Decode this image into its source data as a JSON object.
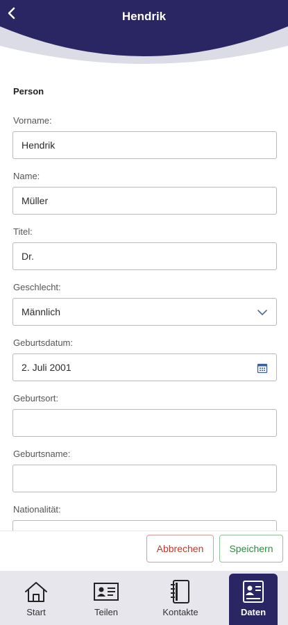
{
  "header": {
    "title": "Hendrik",
    "accent": "#2a2563"
  },
  "form": {
    "section_title": "Person",
    "fields": [
      {
        "label": "Vorname:",
        "value": "Hendrik"
      },
      {
        "label": "Name:",
        "value": "Müller"
      },
      {
        "label": "Titel:",
        "value": "Dr."
      },
      {
        "label": "Geschlecht:",
        "value": "Männlich",
        "type": "select"
      },
      {
        "label": "Geburtsdatum:",
        "value": "2. Juli 2001",
        "type": "date"
      },
      {
        "label": "Geburtsort:",
        "value": ""
      },
      {
        "label": "Geburtsname:",
        "value": ""
      },
      {
        "label": "Nationalität:",
        "value": ""
      }
    ]
  },
  "actions": {
    "cancel_label": "Abbrechen",
    "save_label": "Speichern",
    "cancel_color": "#c0392b",
    "save_color": "#2e8b3d"
  },
  "nav": {
    "items": [
      {
        "label": "Start",
        "icon": "home-icon"
      },
      {
        "label": "Teilen",
        "icon": "id-card-icon"
      },
      {
        "label": "Kontakte",
        "icon": "address-book-icon"
      },
      {
        "label": "Daten",
        "icon": "profile-card-icon",
        "active": true
      }
    ]
  }
}
